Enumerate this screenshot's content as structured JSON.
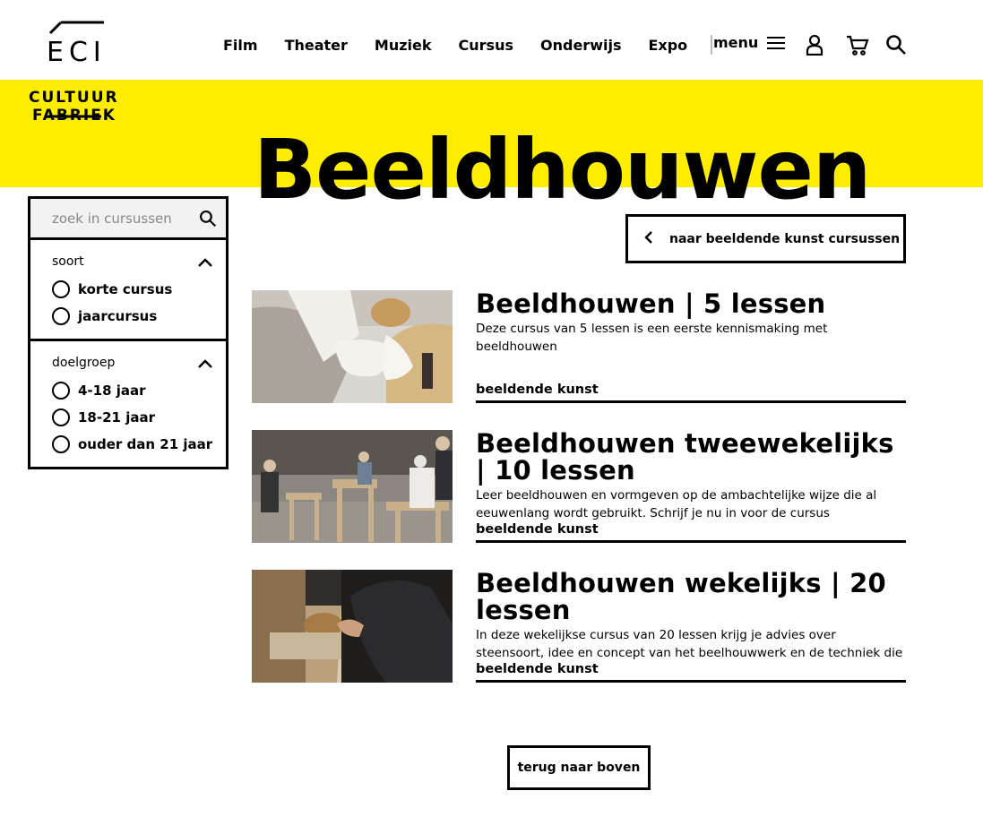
{
  "logo": {
    "line0": "ECI",
    "line1": "CULTUUR",
    "line2": "FABRIEK"
  },
  "nav": {
    "items": [
      "Film",
      "Theater",
      "Muziek",
      "Cursus",
      "Onderwijs",
      "Expo"
    ],
    "menu_label": "menu",
    "icons": [
      "hamburger-icon",
      "user-icon",
      "cart-icon",
      "search-icon"
    ]
  },
  "page": {
    "title": "Beeldhouwen"
  },
  "sidebar": {
    "search_placeholder": "zoek in cursussen",
    "filters": [
      {
        "title": "soort",
        "options": [
          "korte cursus",
          "jaarcursus"
        ]
      },
      {
        "title": "doelgroep",
        "options": [
          "4-18 jaar",
          "18-21 jaar",
          "ouder dan 21 jaar"
        ]
      }
    ]
  },
  "back_button": {
    "label": "naar beeldende kunst cursussen"
  },
  "courses": [
    {
      "title": "Beeldhouwen | 5 lessen",
      "description": "Deze cursus van 5 lessen is een eerste kennismaking met beeldhouwen",
      "tag": "beeldende kunst"
    },
    {
      "title": "Beeldhouwen tweewekelijks | 10 lessen",
      "description": "Leer beeldhouwen en vormgeven op de ambachtelijke wijze die al eeuwenlang wordt gebruikt. Schrijf je nu in voor de cursus beeldhouwen bij",
      "tag": "beeldende kunst"
    },
    {
      "title": "Beeldhouwen wekelijks | 20 lessen",
      "description": "In deze wekelijkse cursus van 20 lessen krijg je advies over steensoort, idee en concept van het beelhouwwerk en de techniek die je kunt gebruiken",
      "tag": "beeldende kunst"
    }
  ],
  "footer": {
    "top_button": "terug naar boven"
  },
  "colors": {
    "accent_yellow": "#ffed00",
    "text": "#000000",
    "search_bg": "#f2f2f2"
  }
}
